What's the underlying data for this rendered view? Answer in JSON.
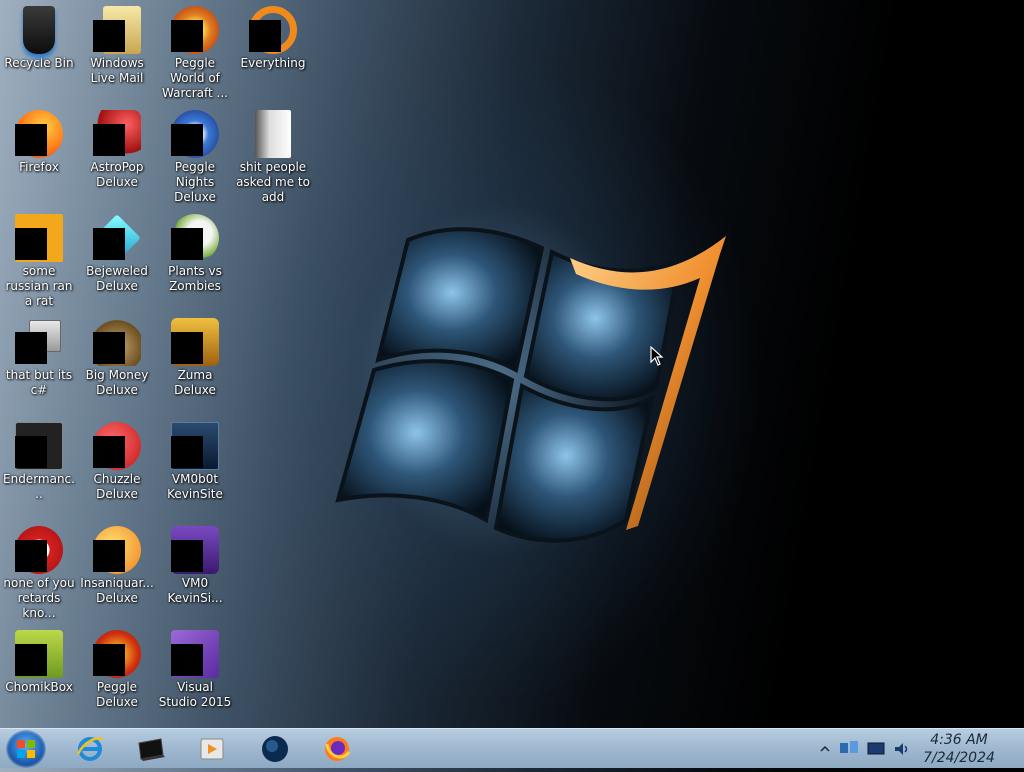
{
  "desktop": {
    "icons": [
      {
        "label": "Recycle Bin",
        "icon": "recycle-bin-icon"
      },
      {
        "label": "Windows Live Mail",
        "icon": "mail-icon"
      },
      {
        "label": "Peggle World of Warcraft ...",
        "icon": "peggle-wow-icon"
      },
      {
        "label": "Everything",
        "icon": "everything-icon"
      },
      {
        "label": "Firefox",
        "icon": "firefox-icon"
      },
      {
        "label": "AstroPop Deluxe",
        "icon": "astropop-icon"
      },
      {
        "label": "Peggle Nights Deluxe",
        "icon": "peggle-nights-icon"
      },
      {
        "label": "shit people asked me to add",
        "icon": "folder-icon"
      },
      {
        "label": "some russian ran a rat",
        "icon": "ae-icon"
      },
      {
        "label": "Bejeweled Deluxe",
        "icon": "bejeweled-icon"
      },
      {
        "label": "Plants vs Zombies",
        "icon": "pvz-icon"
      },
      {
        "label": "that but its c#",
        "icon": "windows-stack-icon"
      },
      {
        "label": "Big Money Deluxe",
        "icon": "money-bag-icon"
      },
      {
        "label": "Zuma Deluxe",
        "icon": "zuma-icon"
      },
      {
        "label": "Endermanc...",
        "icon": "terminal-icon"
      },
      {
        "label": "Chuzzle Deluxe",
        "icon": "chuzzle-icon"
      },
      {
        "label": "VM0b0t KevinSite",
        "icon": "vm-monitor-icon"
      },
      {
        "label": "none of you retards kno...",
        "icon": "red-app-icon"
      },
      {
        "label": "Insaniquar... Deluxe",
        "icon": "insaniquarium-icon"
      },
      {
        "label": "VM0 KevinSi...",
        "icon": "vm-purple-icon"
      },
      {
        "label": "ChomikBox",
        "icon": "chomikbox-icon"
      },
      {
        "label": "Peggle Deluxe",
        "icon": "peggle-icon"
      },
      {
        "label": "Visual Studio 2015",
        "icon": "visual-studio-icon"
      }
    ]
  },
  "taskbar": {
    "pinned": [
      {
        "icon": "internet-explorer-icon"
      },
      {
        "icon": "terminal-box-icon"
      },
      {
        "icon": "media-player-icon"
      },
      {
        "icon": "globe-icon"
      },
      {
        "icon": "firefox-icon"
      }
    ],
    "tray_icons": [
      "show-hidden-icons-chevron",
      "network-icon",
      "display-icon",
      "volume-icon"
    ],
    "clock": {
      "time": "4:36 AM",
      "date": "7/24/2024"
    }
  },
  "colors": {
    "taskbar": "#9fb8cf",
    "logo_accent": "#f0a030"
  }
}
